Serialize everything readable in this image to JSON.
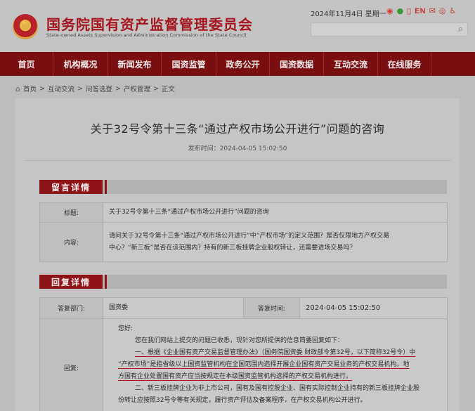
{
  "header": {
    "title": "国务院国有资产监督管理委员会",
    "subtitle": "State-owned Assets Supervision and Administration Commission of the State Council",
    "date": "2024年11月4日 星期一",
    "tools": {
      "en": "EN"
    }
  },
  "nav": {
    "items": [
      "首页",
      "机构概况",
      "新闻发布",
      "国资监管",
      "政务公开",
      "国资数据",
      "互动交流",
      "在线服务"
    ]
  },
  "breadcrumb": [
    "首页",
    "互动交流",
    "问答选登",
    "产权管理",
    "正文"
  ],
  "article": {
    "title": "关于32号令第十三条“通过产权市场公开进行”问题的咨询",
    "publish_label": "发布时间：",
    "publish_time": "2024-04-05 15:02:50"
  },
  "message": {
    "section_title": "留言详情",
    "title_label": "标题:",
    "title_value": "关于32号令第十三条“通过产权市场公开进行”问题的咨询",
    "content_label": "内容:",
    "content_line1": "请问关于32号令第十三条“通过产权市场公开进行”中“产权市场”的定义范围？是否仅限地方产权交易",
    "content_line2": "中心？“新三板”是否在该范围内？持有的新三板挂牌企业股权转让，还需要进场交易吗？"
  },
  "reply": {
    "section_title": "回复详情",
    "dept_label": "答复部门:",
    "dept_value": "国资委",
    "time_label": "答复时间:",
    "time_value": "2024-04-05 15:02:50",
    "label": "回复:",
    "line1": "您好:",
    "line2": "您在我们网站上提交的问题已收悉，现针对您所提供的信息简要回复如下：",
    "line3": "一、根据《企业国有资产交易监督管理办法》（国务院国资委 财政部令第32号，以下简称32号令）中",
    "line4": "“产权市场”是指省级以上国资监管机构在全国范围内选择开展企业国有资产交易业务的产权交易机构。地",
    "line5": "方国有企业处置国有资产应当按规定在本级国资监管机构选择的产权交易机构进行。",
    "line6": "二、新三板挂牌企业为非上市公司，国有及国有控股企业、国有实际控制企业持有的新三板挂牌企业股",
    "line7": "份转让应按照32号令等有关规定，履行资产评估及备案程序，在产权交易机构公开进行。"
  }
}
